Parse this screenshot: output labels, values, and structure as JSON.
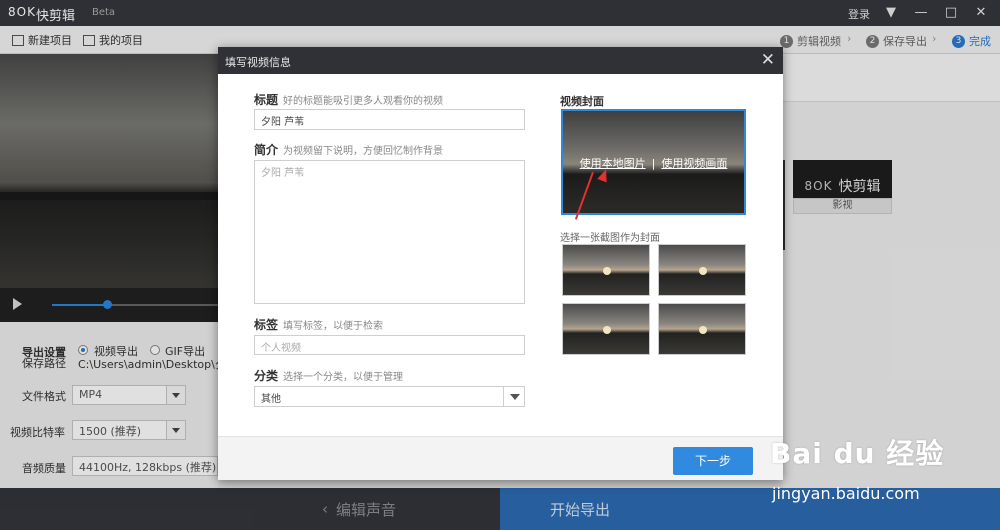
{
  "app": {
    "logo_text": "8OK",
    "name": "快剪辑",
    "beta": "Beta",
    "login": "登录"
  },
  "toolbar": {
    "new_project": "新建项目",
    "my_projects": "我的项目",
    "steps": [
      {
        "num": "1",
        "label": "剪辑视频"
      },
      {
        "num": "2",
        "label": "保存导出"
      },
      {
        "num": "3",
        "label": "完成"
      }
    ]
  },
  "player": {
    "progress": 0.33
  },
  "export_settings": {
    "title": "导出设置",
    "save_path_label": "保存路径",
    "export_video": "视频导出",
    "export_gif": "GIF导出",
    "save_path": "C:\\Users\\admin\\Desktop\\夕阳",
    "format_label": "文件格式",
    "format_value": "MP4",
    "bitrate_label": "视频比特率",
    "bitrate_value": "1500 (推荐)",
    "audio_label": "音频质量",
    "audio_value": "44100Hz, 128kbps (推荐)"
  },
  "right_panel": {
    "brand_logo": "8OK",
    "brand_name": "快剪辑",
    "brand_label": "影视"
  },
  "bottom": {
    "edit_audio": "编辑声音",
    "start_export": "开始导出"
  },
  "dialog": {
    "title": "填写视频信息",
    "close": "✕",
    "title_field": {
      "label": "标题",
      "hint": "好的标题能吸引更多人观看你的视频",
      "value": "夕阳 芦苇"
    },
    "intro_field": {
      "label": "简介",
      "hint": "为视频留下说明，方便回忆制作背景",
      "value": "夕阳 芦苇"
    },
    "tags_field": {
      "label": "标签",
      "hint": "填写标签，以便于检索",
      "placeholder": "个人视频"
    },
    "category_field": {
      "label": "分类",
      "hint": "选择一个分类，以便于管理",
      "value": "其他"
    },
    "cover": {
      "title": "视频封面",
      "use_local": "使用本地图片",
      "separator": "|",
      "use_frame": "使用视频画面",
      "shots_hint": "选择一张截图作为封面"
    },
    "next_button": "下一步"
  },
  "watermark": {
    "logo": "Bai du 经验",
    "url": "jingyan.baidu.com"
  }
}
